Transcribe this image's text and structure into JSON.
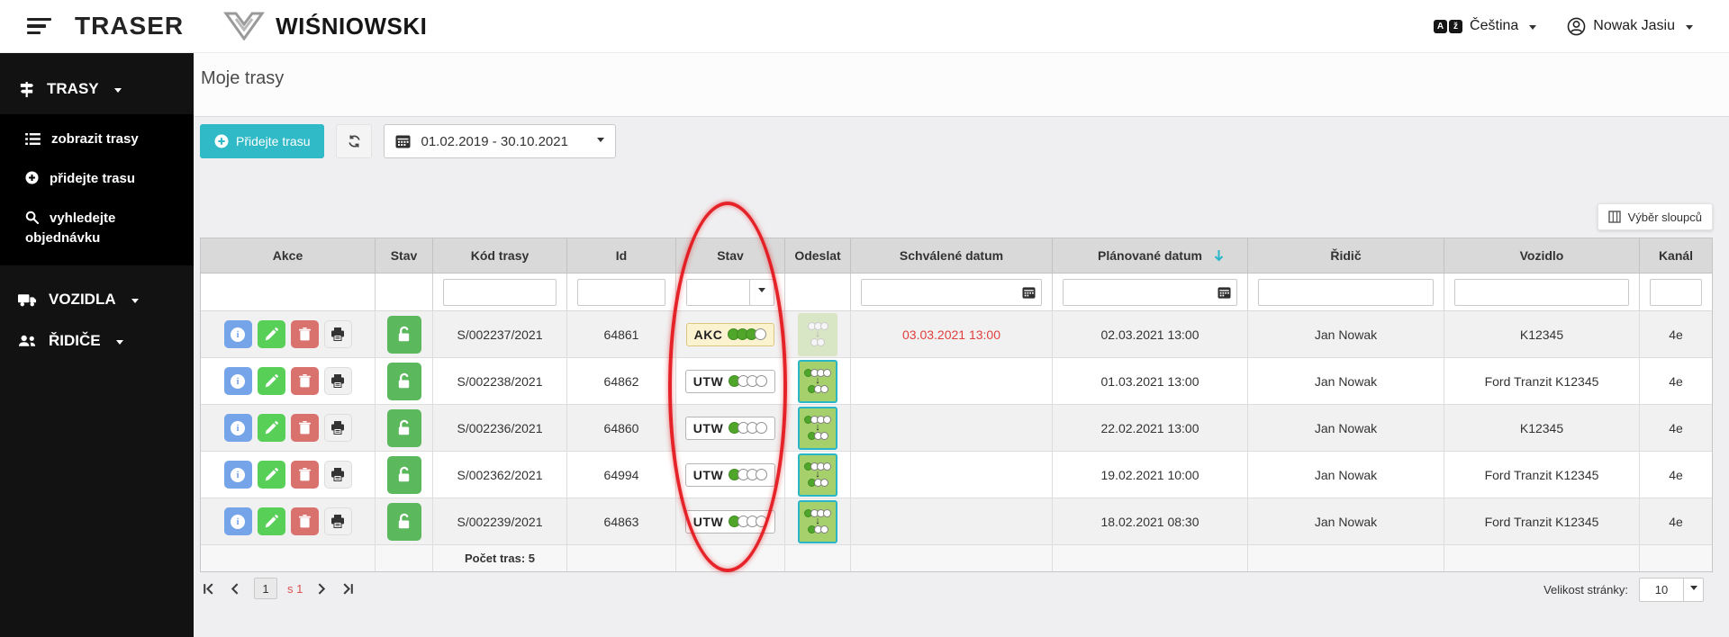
{
  "topbar": {
    "app_title": "TRASER",
    "brand": "WIŚNIOWSKI",
    "language": "Čeština",
    "user": "Nowak Jasiu"
  },
  "sidebar": {
    "trasy_label": "TRASY",
    "trasy_items": [
      {
        "label": "zobrazit trasy",
        "icon": "list-icon"
      },
      {
        "label": "přidejte trasu",
        "icon": "plus-circle-icon"
      },
      {
        "label": "vyhledejte objednávku",
        "icon": "search-icon"
      }
    ],
    "vozidla_label": "VOZIDLA",
    "ridice_label": "ŘIDIČE"
  },
  "page": {
    "title": "Moje trasy"
  },
  "toolbar": {
    "add_button": "Přidejte trasu",
    "date_range": "01.02.2019 - 30.10.2021",
    "column_picker": "Výběr sloupců"
  },
  "table": {
    "headers": [
      "Akce",
      "Stav",
      "Kód trasy",
      "Id",
      "Stav",
      "Odeslat",
      "Schválené datum",
      "Plánované datum",
      "Řidič",
      "Vozidlo",
      "Kanál"
    ],
    "sorted_column": "Plánované datum",
    "sort_direction": "desc",
    "rows": [
      {
        "code": "S/002237/2021",
        "id": "64861",
        "status": "AKC",
        "status_badge": "akc",
        "dots": [
          1,
          1,
          1,
          0
        ],
        "send_enabled": false,
        "approved": "03.03.2021 13:00",
        "approved_red": true,
        "planned": "02.03.2021 13:00",
        "driver": "Jan Nowak",
        "vehicle": "K12345",
        "channel": "4e"
      },
      {
        "code": "S/002238/2021",
        "id": "64862",
        "status": "UTW",
        "status_badge": "utw",
        "dots": [
          1,
          0,
          0,
          0
        ],
        "send_enabled": true,
        "approved": "",
        "approved_red": false,
        "planned": "01.03.2021 13:00",
        "driver": "Jan Nowak",
        "vehicle": "Ford Tranzit K12345",
        "channel": "4e"
      },
      {
        "code": "S/002236/2021",
        "id": "64860",
        "status": "UTW",
        "status_badge": "utw",
        "dots": [
          1,
          0,
          0,
          0
        ],
        "send_enabled": true,
        "approved": "",
        "approved_red": false,
        "planned": "22.02.2021 13:00",
        "driver": "Jan Nowak",
        "vehicle": "K12345",
        "channel": "4e"
      },
      {
        "code": "S/002362/2021",
        "id": "64994",
        "status": "UTW",
        "status_badge": "utw",
        "dots": [
          1,
          0,
          0,
          0
        ],
        "send_enabled": true,
        "approved": "",
        "approved_red": false,
        "planned": "19.02.2021 10:00",
        "driver": "Jan Nowak",
        "vehicle": "Ford Tranzit K12345",
        "channel": "4e"
      },
      {
        "code": "S/002239/2021",
        "id": "64863",
        "status": "UTW",
        "status_badge": "utw",
        "dots": [
          1,
          0,
          0,
          0
        ],
        "send_enabled": true,
        "approved": "",
        "approved_red": false,
        "planned": "18.02.2021 08:30",
        "driver": "Jan Nowak",
        "vehicle": "Ford Tranzit K12345",
        "channel": "4e"
      }
    ],
    "footer_total": "Počet tras: 5"
  },
  "pager": {
    "current_page": "1",
    "of_label": "s 1",
    "size_label": "Velikost stránky:",
    "size_value": "10"
  },
  "icons": {
    "annotation": "red-ellipse-highlight-on-stav-column",
    "status_dot_filled": "#4fa62b",
    "accent_teal": "#30b9c6",
    "alert_red": "#e03e3e"
  }
}
